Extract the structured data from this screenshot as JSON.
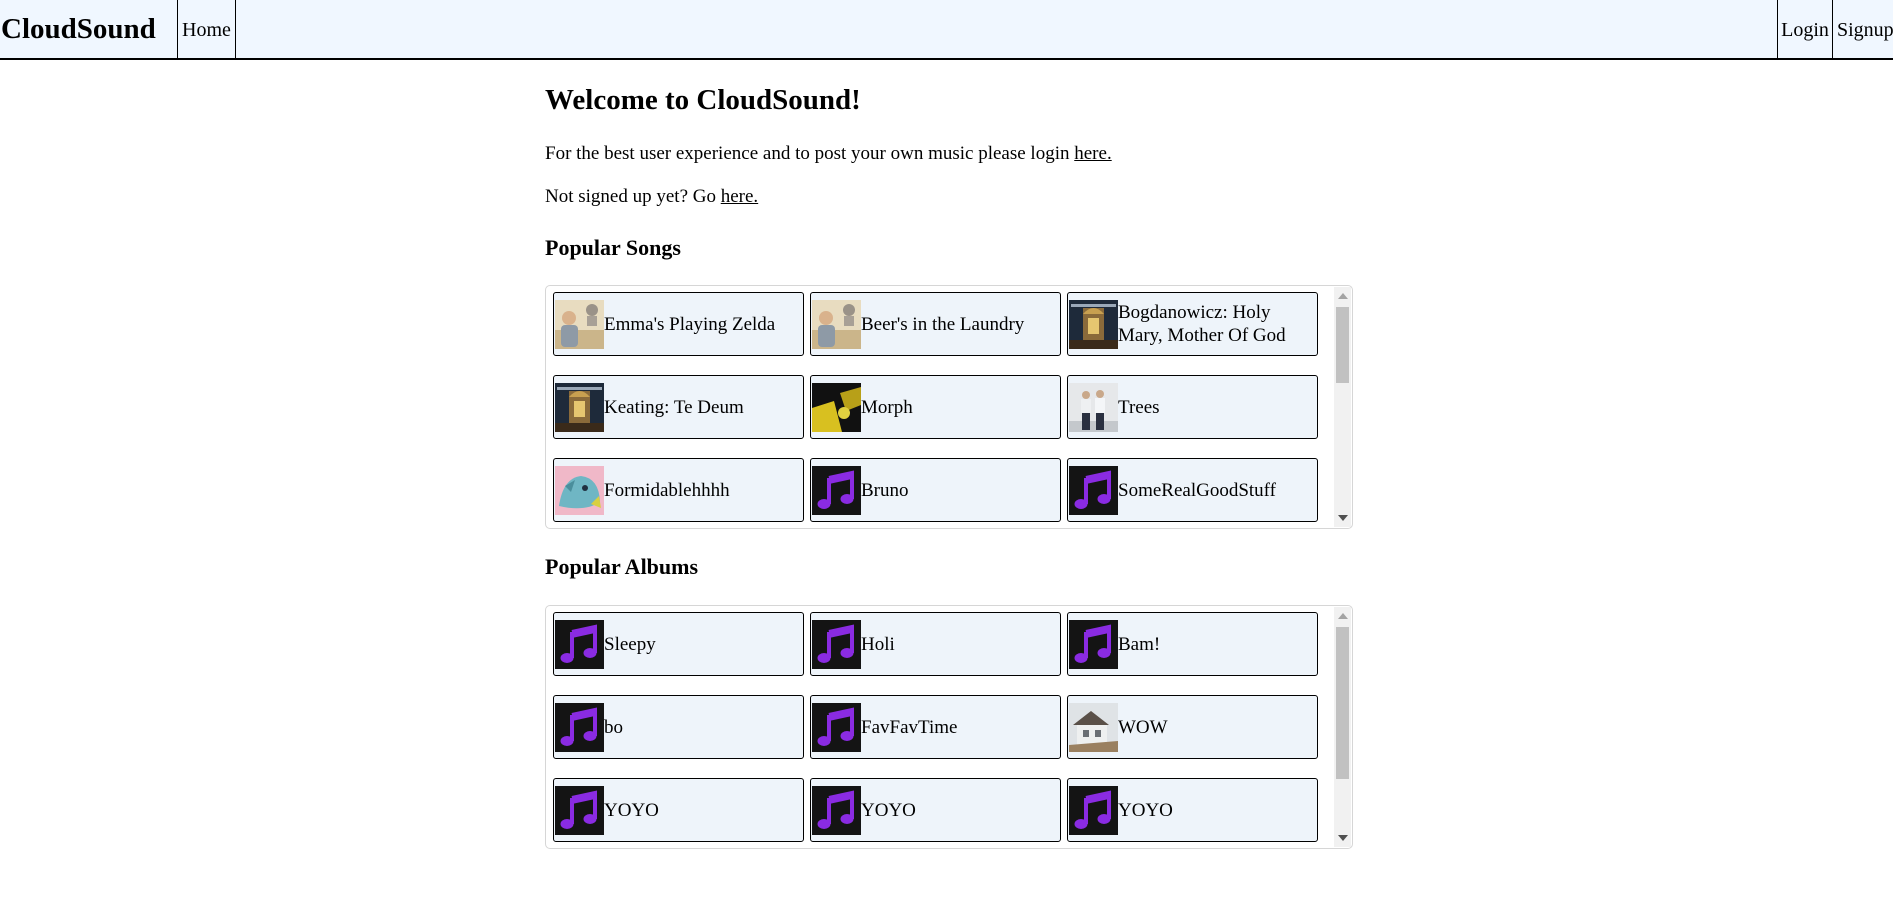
{
  "navbar": {
    "brand": "CloudSound",
    "home": "Home",
    "login": "Login",
    "signup": "Signup",
    "bg_color": "#f0f7ff"
  },
  "main": {
    "welcome": "Welcome to CloudSound!",
    "login_prompt": "For the best user experience and to post your own music please login ",
    "login_link": "here.",
    "signup_prompt": "Not signed up yet? Go ",
    "signup_link": "here."
  },
  "popular_songs": {
    "heading": "Popular Songs",
    "items": [
      {
        "title": "Emma's Playing Zelda",
        "thumb": "photo-man-with-bust"
      },
      {
        "title": "Beer's in the Laundry",
        "thumb": "photo-man-with-bust"
      },
      {
        "title": "Bogdanowicz: Holy Mary, Mother Of God",
        "thumb": "photo-church-interior"
      },
      {
        "title": "Keating: Te Deum",
        "thumb": "photo-church-interior"
      },
      {
        "title": "Morph",
        "thumb": "photo-yellow-black-art"
      },
      {
        "title": "Trees",
        "thumb": "photo-two-men"
      },
      {
        "title": "Formidablehhhh",
        "thumb": "illustration-blue-creature"
      },
      {
        "title": "Bruno",
        "thumb": "music-note-icon"
      },
      {
        "title": "SomeRealGoodStuff",
        "thumb": "music-note-icon"
      }
    ]
  },
  "popular_albums": {
    "heading": "Popular Albums",
    "items": [
      {
        "title": "Sleepy",
        "thumb": "music-note-icon"
      },
      {
        "title": "Holi",
        "thumb": "music-note-icon"
      },
      {
        "title": "Bam!",
        "thumb": "music-note-icon"
      },
      {
        "title": "bo",
        "thumb": "music-note-icon"
      },
      {
        "title": "FavFavTime",
        "thumb": "music-note-icon"
      },
      {
        "title": "WOW",
        "thumb": "photo-house-snow"
      },
      {
        "title": "YOYO",
        "thumb": "music-note-icon"
      },
      {
        "title": "YOYO",
        "thumb": "music-note-icon"
      },
      {
        "title": "YOYO",
        "thumb": "music-note-icon"
      }
    ]
  },
  "colors": {
    "card_bg": "#eef4fa",
    "note_purple": "#8a2be2",
    "note_bg": "#141414"
  }
}
